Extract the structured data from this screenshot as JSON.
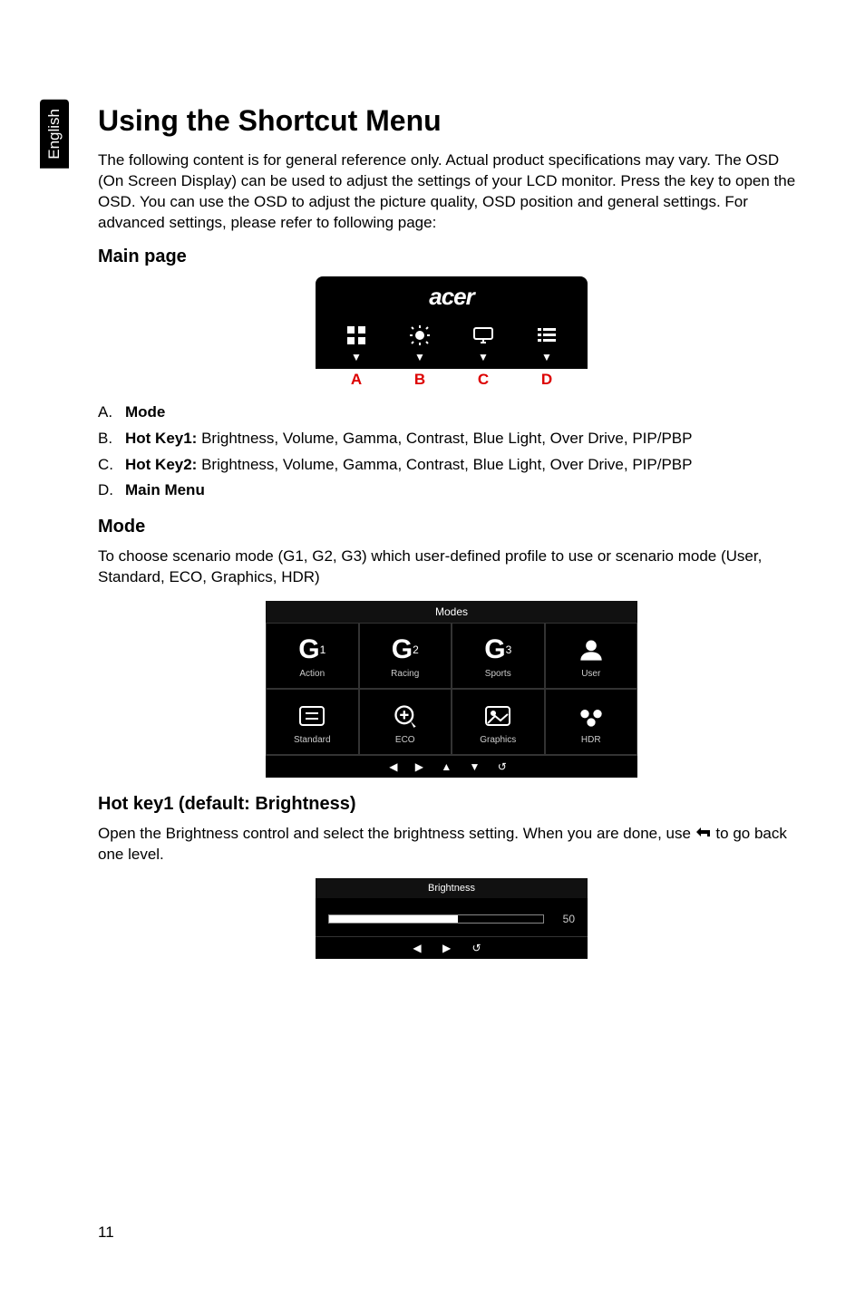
{
  "lang_tab": "English",
  "page_number": "11",
  "h1": "Using the Shortcut Menu",
  "intro": "The following content is for general reference only. Actual product specifications may vary. The OSD (On Screen Display) can be used to adjust the settings of your LCD monitor. Press the key to open the OSD. You can use the OSD to adjust the picture quality, OSD position and general settings. For advanced settings, please refer to following page:",
  "main_page_heading": "Main page",
  "osd_logo": "acer",
  "osd_letters": {
    "a": "A",
    "b": "B",
    "c": "C",
    "d": "D"
  },
  "list": {
    "a": {
      "marker": "A.",
      "bold": "Mode",
      "rest": ""
    },
    "b": {
      "marker": "B.",
      "bold": "Hot Key1:",
      "rest": " Brightness, Volume, Gamma, Contrast, Blue Light, Over Drive, PIP/PBP"
    },
    "c": {
      "marker": "C.",
      "bold": "Hot Key2:",
      "rest": " Brightness, Volume, Gamma, Contrast, Blue Light, Over Drive, PIP/PBP"
    },
    "d": {
      "marker": "D.",
      "bold": "Main Menu",
      "rest": ""
    }
  },
  "mode_heading": "Mode",
  "mode_text": "To choose scenario mode (G1, G2, G3) which user-defined profile to use or scenario mode (User, Standard, ECO, Graphics, HDR)",
  "modes_panel": {
    "header": "Modes",
    "tiles": {
      "g1": {
        "sup": "1",
        "label": "Action"
      },
      "g2": {
        "sup": "2",
        "label": "Racing"
      },
      "g3": {
        "sup": "3",
        "label": "Sports"
      },
      "user": {
        "label": "User"
      },
      "standard": {
        "label": "Standard"
      },
      "eco": {
        "label": "ECO"
      },
      "graphics": {
        "label": "Graphics"
      },
      "hdr": {
        "label": "HDR"
      }
    },
    "nav": "◀  ▶  ▲  ▼  ↺"
  },
  "hotkey1_heading": "Hot key1 (default: Brightness)",
  "hotkey1_text_a": "Open the Brightness control and select the brightness setting. When you are done, use ",
  "hotkey1_text_b": " to go back one level.",
  "brightness_panel": {
    "header": "Brightness",
    "value": "50",
    "nav": "◀   ▶   ↺"
  }
}
